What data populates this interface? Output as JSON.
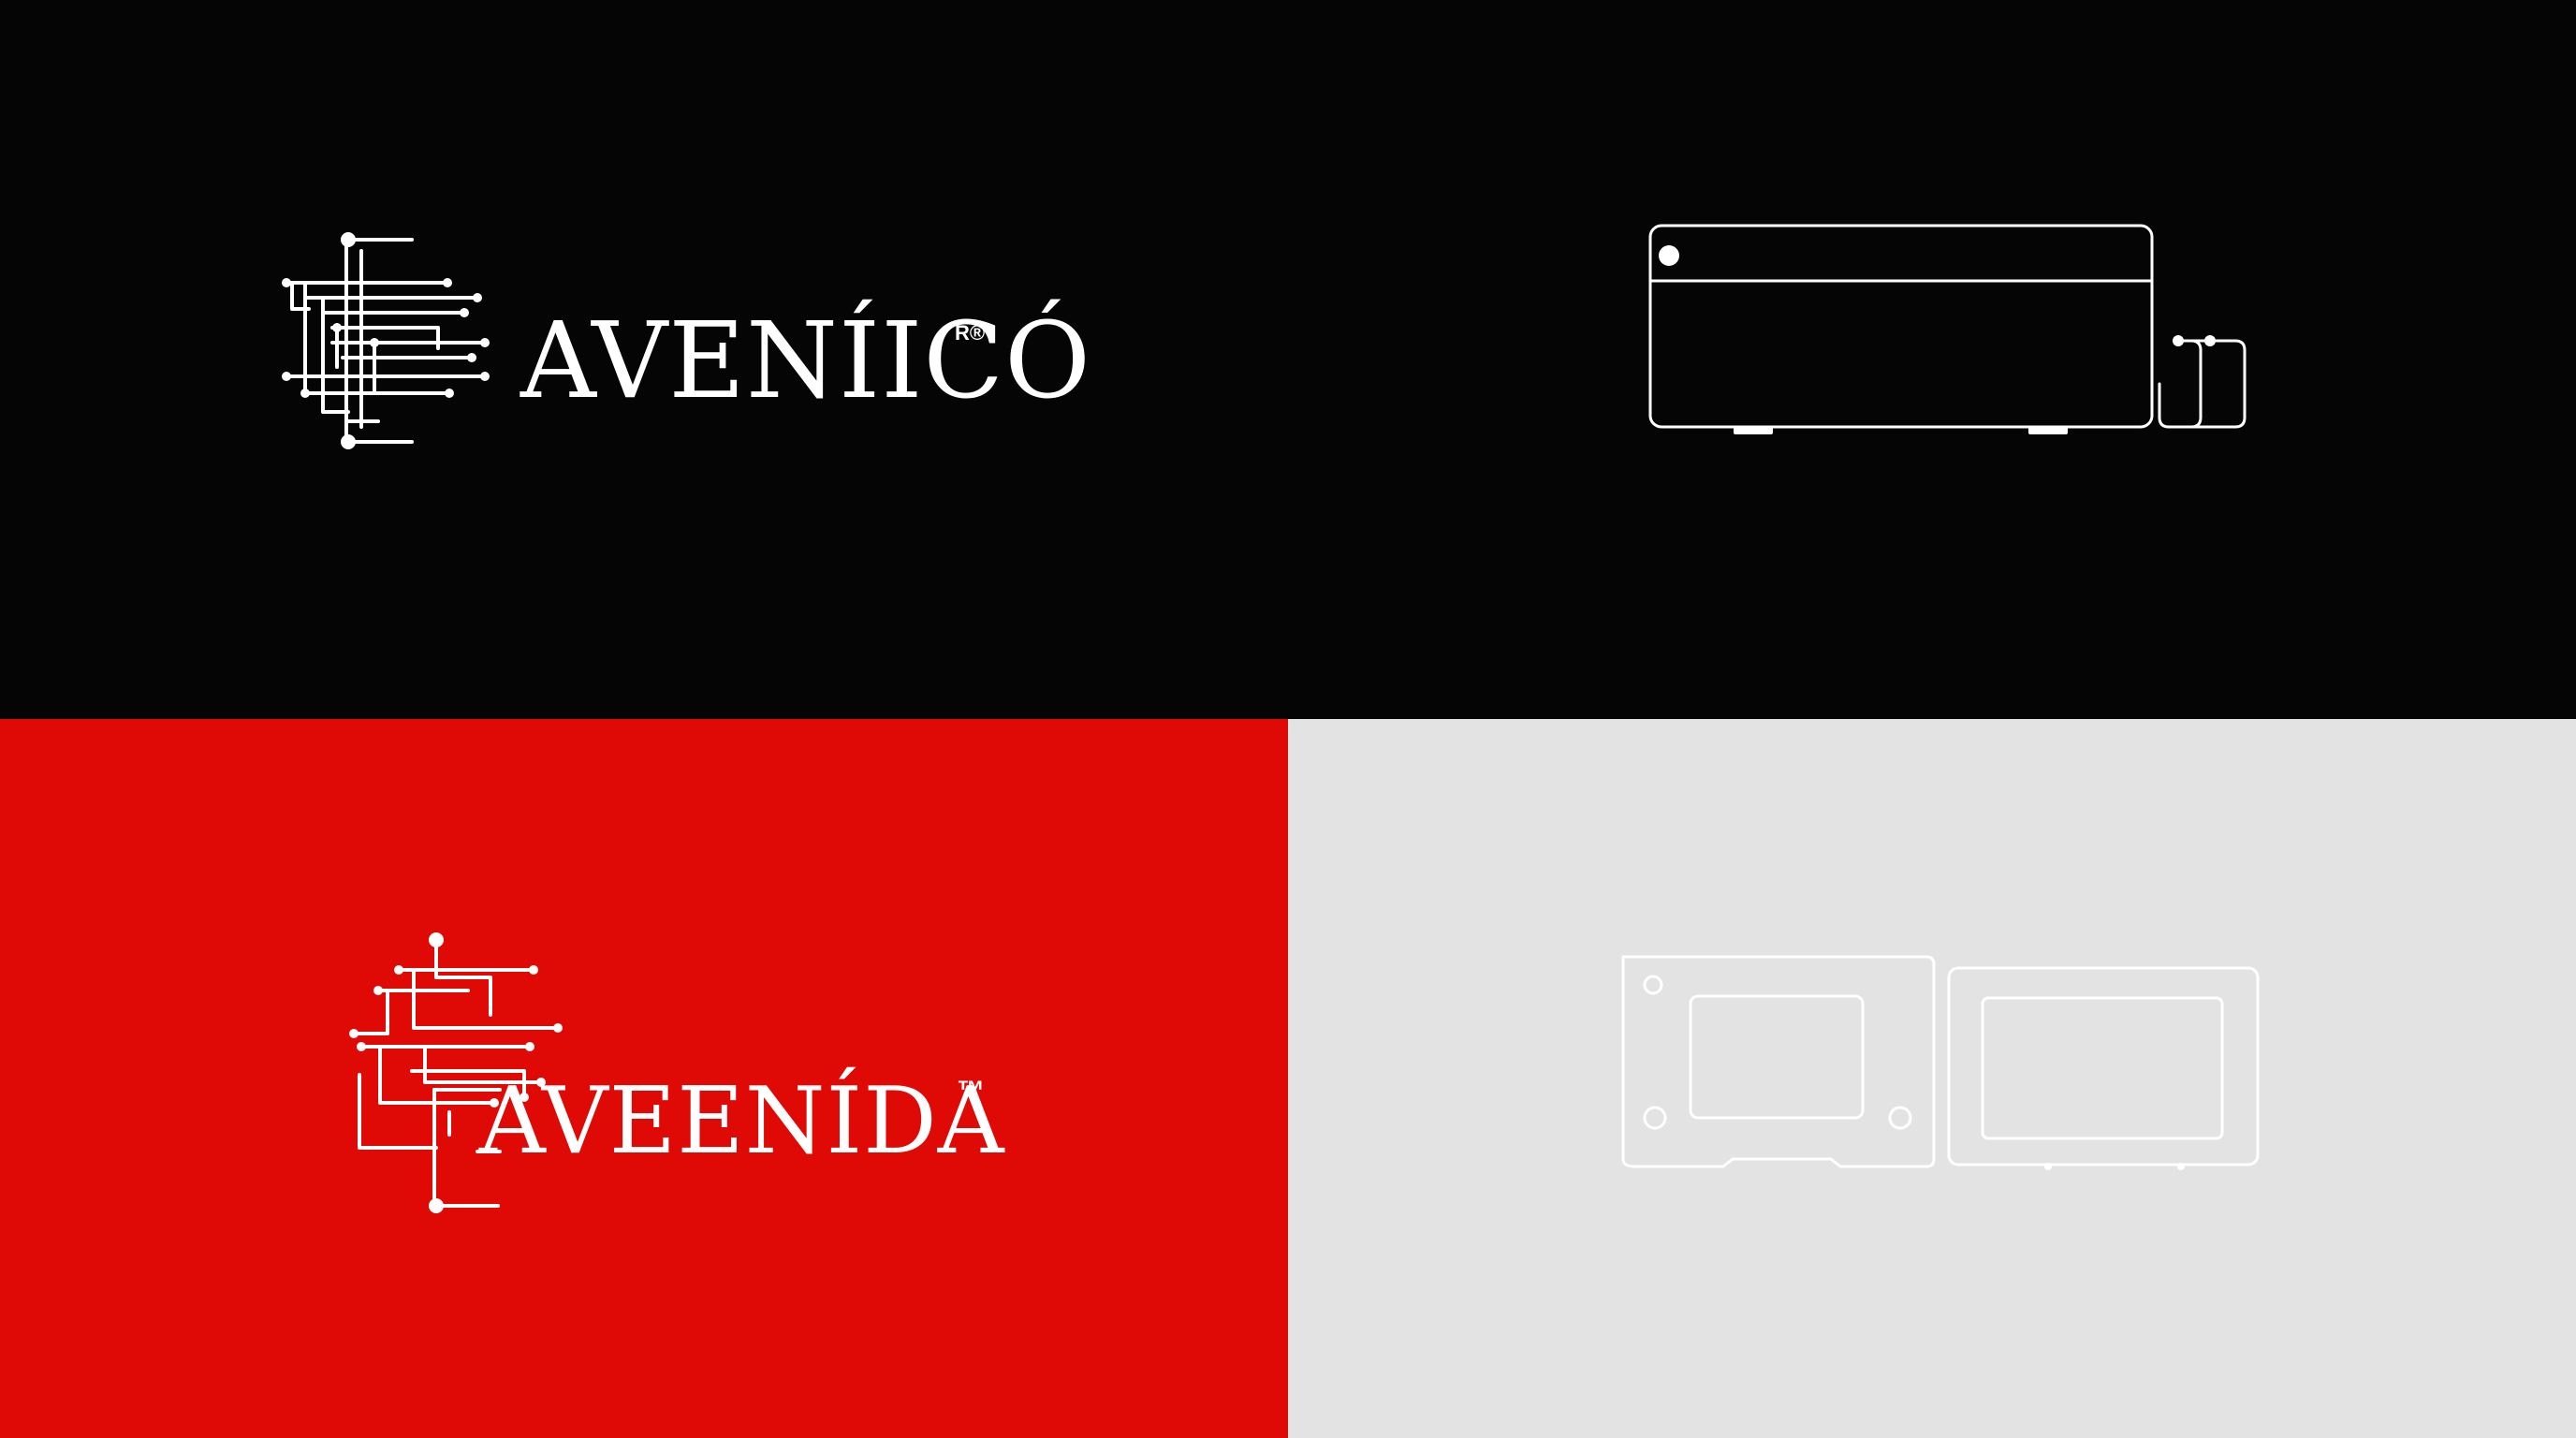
{
  "panels": {
    "top_left": {
      "background": "#050505",
      "wordmark": "AVENÍICÓ",
      "registered_mark": "R®"
    },
    "top_right": {
      "background": "#050505",
      "icon": "device-outline-icon"
    },
    "bottom_left": {
      "background": "#df0a06",
      "wordmark": "AVEENÍDA",
      "trademark": "™"
    },
    "bottom_right": {
      "background": "#e3e3e3",
      "icon": "dual-panel-outline-icon"
    }
  },
  "colors": {
    "line": "#ffffff",
    "black": "#050505",
    "red": "#df0a06",
    "light_gray": "#e3e3e3"
  }
}
